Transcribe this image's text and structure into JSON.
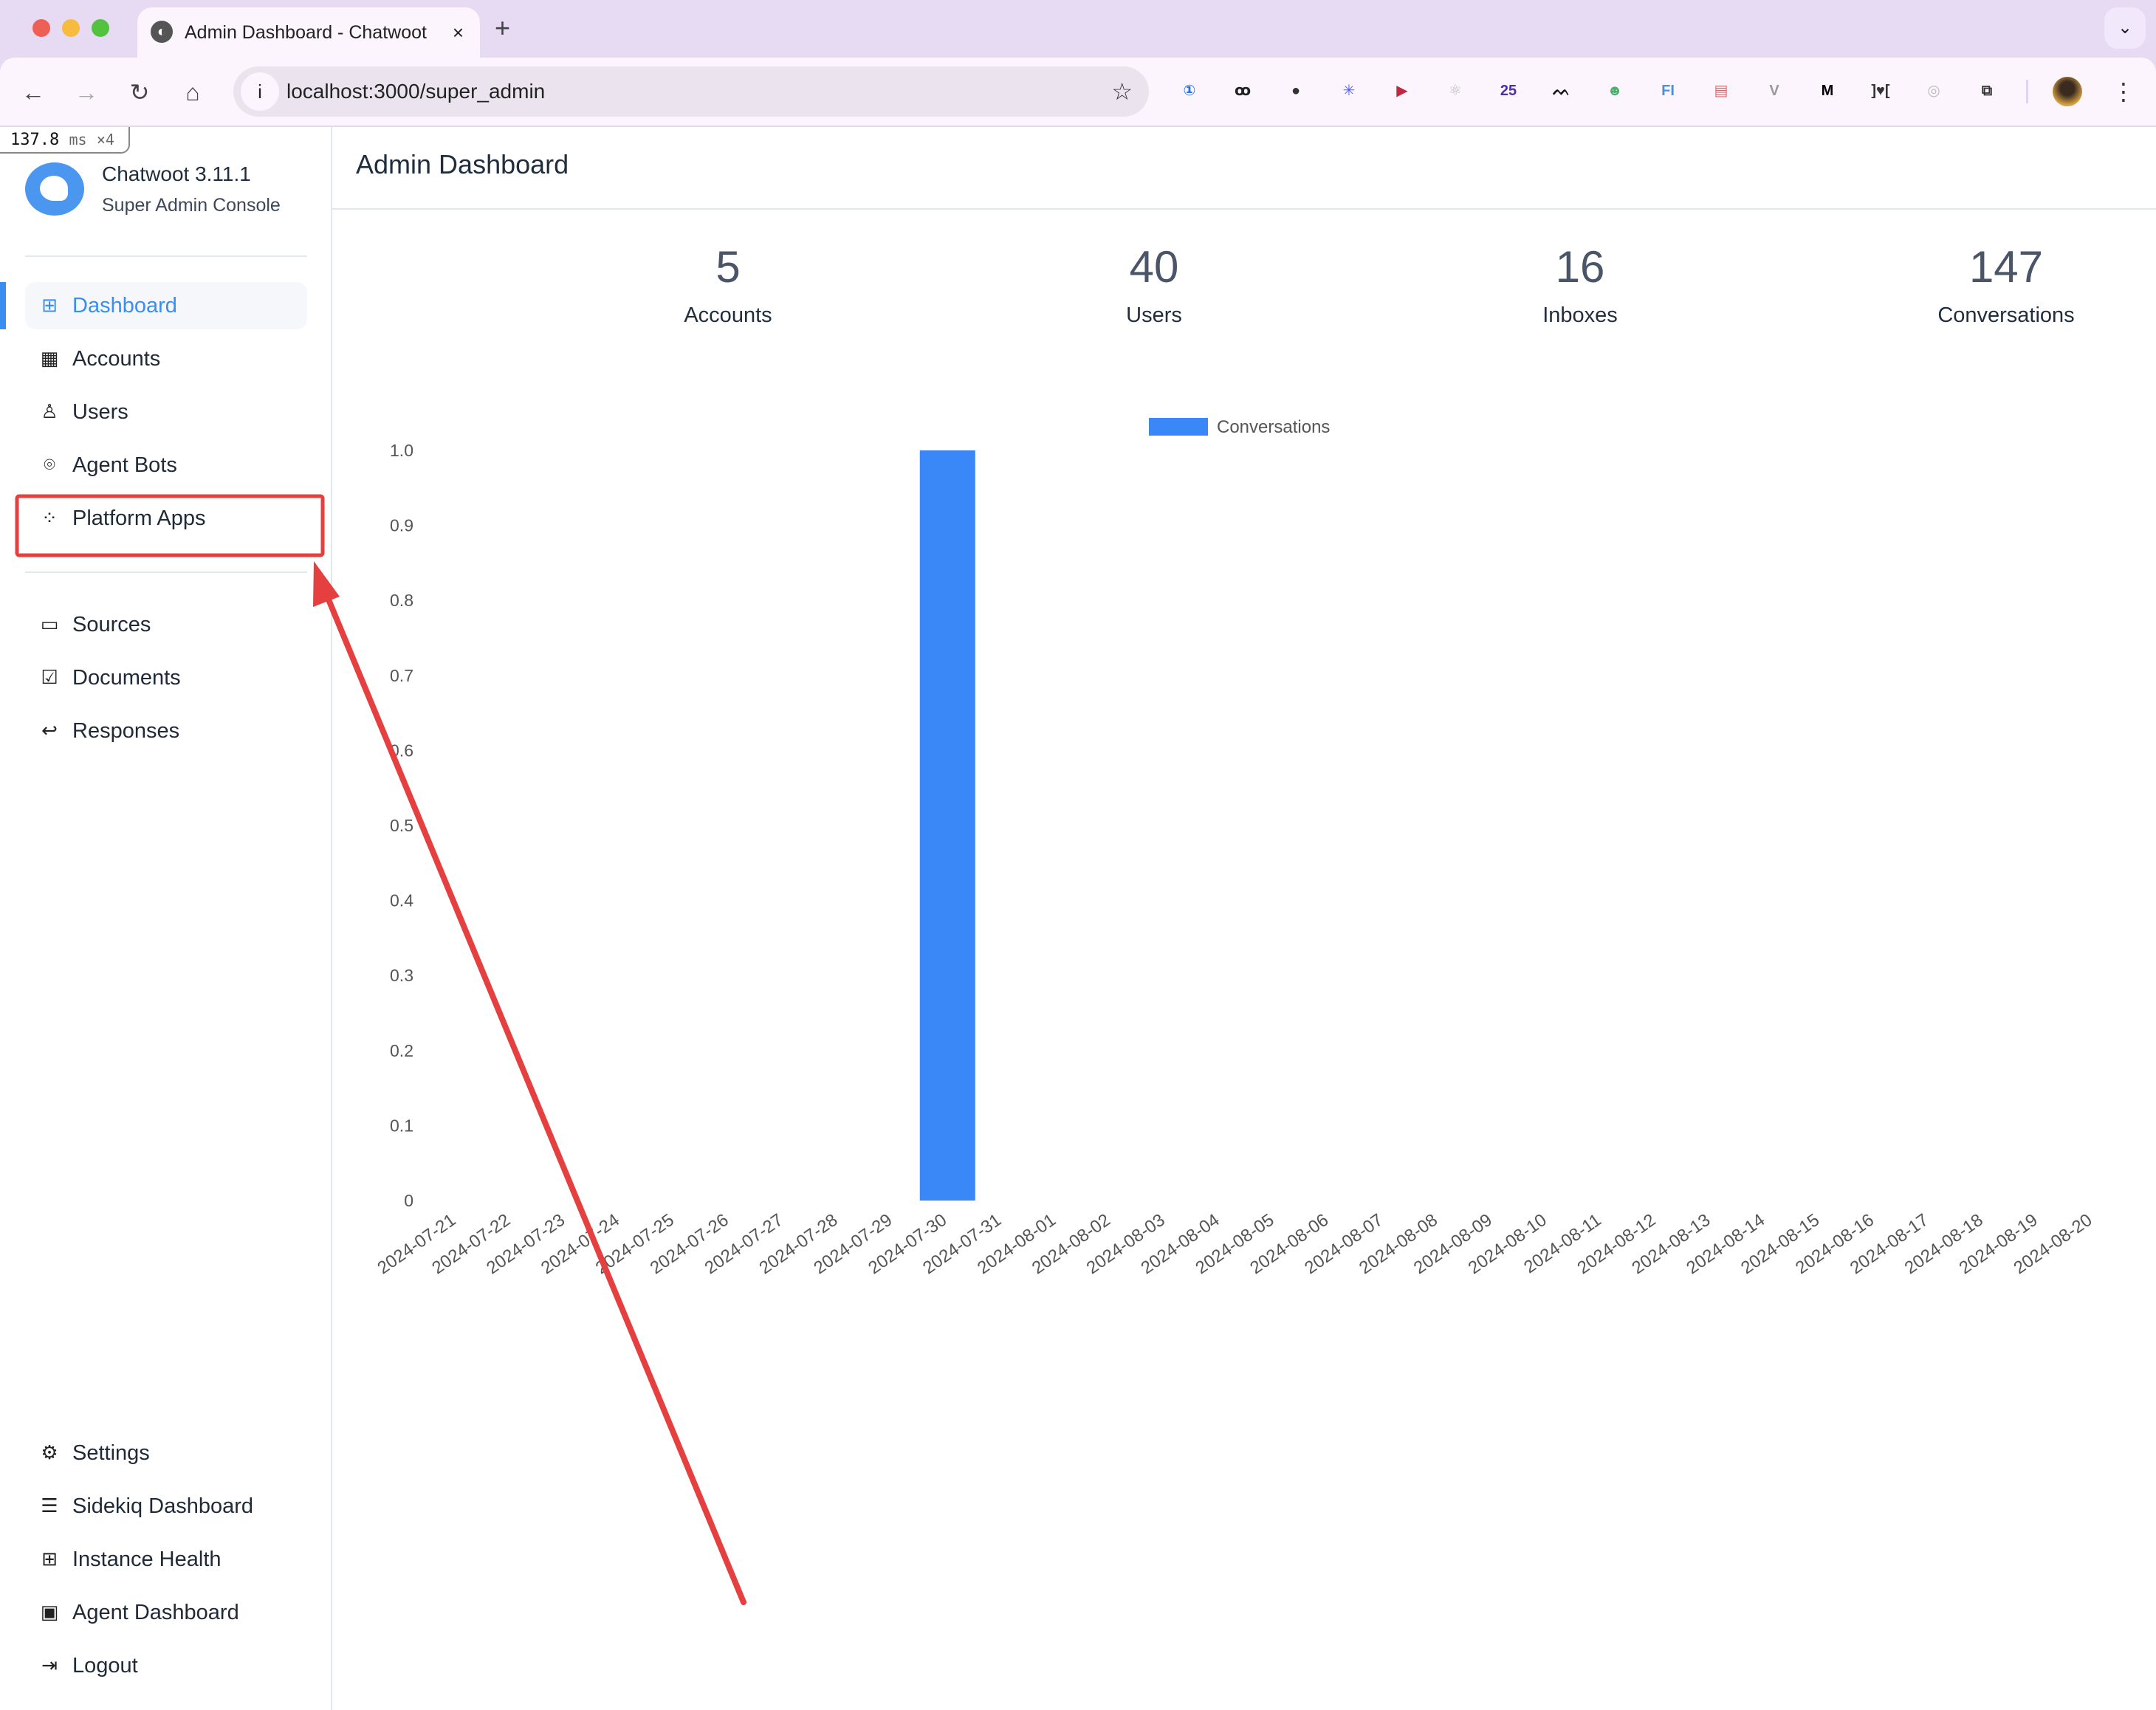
{
  "browser": {
    "tab_title": "Admin Dashboard - Chatwoot",
    "tab_close": "×",
    "new_tab": "+",
    "tab_menu": "⌄",
    "url": "localhost:3000/super_admin",
    "back": "←",
    "forward": "→",
    "reload": "↻",
    "home": "⌂",
    "info": "i",
    "star": "☆",
    "kebab": "⋮",
    "extensions": [
      {
        "name": "1password-extension-icon",
        "glyph": "①",
        "color": "#1a73e8"
      },
      {
        "name": "glasses-extension-icon",
        "glyph": "ꝏ",
        "color": "#222"
      },
      {
        "name": "cat-extension-icon",
        "glyph": "●",
        "color": "#333"
      },
      {
        "name": "asterisk-extension-icon",
        "glyph": "✳",
        "color": "#4f5ef0"
      },
      {
        "name": "play-extension-icon",
        "glyph": "▶",
        "color": "#c0283c"
      },
      {
        "name": "react-extension-icon",
        "glyph": "⚛",
        "color": "#bbb"
      },
      {
        "name": "badge-extension-icon",
        "glyph": "25",
        "color": "#4b2fa5"
      },
      {
        "name": "mountain-extension-icon",
        "glyph": "ᨓ",
        "color": "#111"
      },
      {
        "name": "robot-extension-icon",
        "glyph": "☻",
        "color": "#48b06a"
      },
      {
        "name": "fi-extension-icon",
        "glyph": "FI",
        "color": "#4a90d9"
      },
      {
        "name": "notes-extension-icon",
        "glyph": "▤",
        "color": "#d66"
      },
      {
        "name": "vue-extension-icon",
        "glyph": "V",
        "color": "#999"
      },
      {
        "name": "m-extension-icon",
        "glyph": "M",
        "color": "#000"
      },
      {
        "name": "bracket-extension-icon",
        "glyph": "]♥[",
        "color": "#333"
      },
      {
        "name": "ring-extension-icon",
        "glyph": "◎",
        "color": "#bbb"
      },
      {
        "name": "puzzle-extension-icon",
        "glyph": "⧉",
        "color": "#333"
      }
    ]
  },
  "perf_overlay": {
    "value": "137.8",
    "unit": "ms",
    "mult": "×4"
  },
  "sidebar": {
    "brand_name": "Chatwoot 3.11.1",
    "brand_sub": "Super Admin Console",
    "primary": [
      {
        "label": "Dashboard",
        "icon": "⊞",
        "icon_name": "grid-icon",
        "active": true
      },
      {
        "label": "Accounts",
        "icon": "▦",
        "icon_name": "building-icon"
      },
      {
        "label": "Users",
        "icon": "♙",
        "icon_name": "user-check-icon"
      },
      {
        "label": "Agent Bots",
        "icon": "⌾",
        "icon_name": "bot-icon"
      },
      {
        "label": "Platform Apps",
        "icon": "⁘",
        "icon_name": "apps-icon"
      }
    ],
    "secondary": [
      {
        "label": "Sources",
        "icon": "▭",
        "icon_name": "folder-icon"
      },
      {
        "label": "Documents",
        "icon": "☑",
        "icon_name": "document-edit-icon"
      },
      {
        "label": "Responses",
        "icon": "↩",
        "icon_name": "reply-icon"
      }
    ],
    "bottom": [
      {
        "label": "Settings",
        "icon": "⚙",
        "icon_name": "settings-icon"
      },
      {
        "label": "Sidekiq Dashboard",
        "icon": "☰",
        "icon_name": "sliders-icon"
      },
      {
        "label": "Instance Health",
        "icon": "⊞",
        "icon_name": "health-icon"
      },
      {
        "label": "Agent Dashboard",
        "icon": "▣",
        "icon_name": "dashboard-icon"
      },
      {
        "label": "Logout",
        "icon": "⇥",
        "icon_name": "logout-icon"
      }
    ]
  },
  "main": {
    "title": "Admin Dashboard",
    "stats": [
      {
        "value": "5",
        "label": "Accounts"
      },
      {
        "value": "40",
        "label": "Users"
      },
      {
        "value": "16",
        "label": "Inboxes"
      },
      {
        "value": "147",
        "label": "Conversations"
      }
    ]
  },
  "colors": {
    "accent": "#3b8df0",
    "bar": "#3a88f8",
    "annotation": "#e5403f"
  },
  "chart_data": {
    "type": "bar",
    "title": "",
    "xlabel": "",
    "ylabel": "",
    "legend": "top-center",
    "grid": false,
    "ylim": [
      0,
      1.0
    ],
    "yticks": [
      "0",
      "0.1",
      "0.2",
      "0.3",
      "0.4",
      "0.5",
      "0.6",
      "0.7",
      "0.8",
      "0.9",
      "1.0"
    ],
    "categories": [
      "2024-07-21",
      "2024-07-22",
      "2024-07-23",
      "2024-07-24",
      "2024-07-25",
      "2024-07-26",
      "2024-07-27",
      "2024-07-28",
      "2024-07-29",
      "2024-07-30",
      "2024-07-31",
      "2024-08-01",
      "2024-08-02",
      "2024-08-03",
      "2024-08-04",
      "2024-08-05",
      "2024-08-06",
      "2024-08-07",
      "2024-08-08",
      "2024-08-09",
      "2024-08-10",
      "2024-08-11",
      "2024-08-12",
      "2024-08-13",
      "2024-08-14",
      "2024-08-15",
      "2024-08-16",
      "2024-08-17",
      "2024-08-18",
      "2024-08-19",
      "2024-08-20"
    ],
    "series": [
      {
        "name": "Conversations",
        "values": [
          0,
          0,
          0,
          0,
          0,
          0,
          0,
          0,
          0,
          1,
          0,
          0,
          0,
          0,
          0,
          0,
          0,
          0,
          0,
          0,
          0,
          0,
          0,
          0,
          0,
          0,
          0,
          0,
          0,
          0,
          0
        ]
      }
    ]
  }
}
